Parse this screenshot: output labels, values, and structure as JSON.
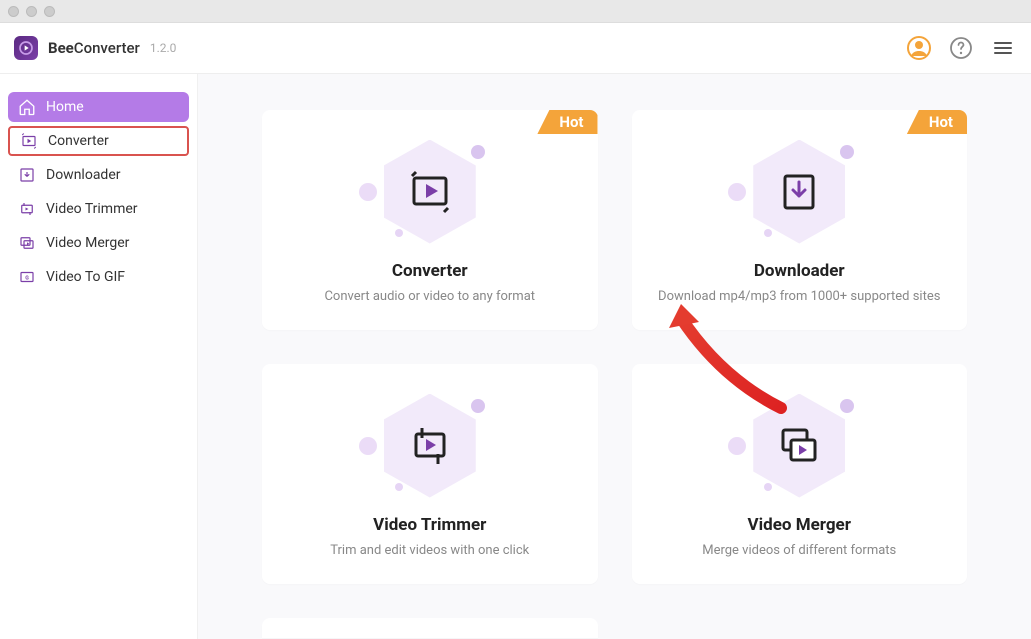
{
  "header": {
    "app_name_prefix": "Bee",
    "app_name_suffix": "Converter",
    "version": "1.2.0"
  },
  "sidebar": {
    "items": [
      {
        "label": "Home"
      },
      {
        "label": "Converter"
      },
      {
        "label": "Downloader"
      },
      {
        "label": "Video Trimmer"
      },
      {
        "label": "Video Merger"
      },
      {
        "label": "Video To GIF"
      }
    ]
  },
  "cards": [
    {
      "title": "Converter",
      "desc": "Convert audio or video to any format",
      "hot": "Hot"
    },
    {
      "title": "Downloader",
      "desc": "Download mp4/mp3 from 1000+ supported sites",
      "hot": "Hot"
    },
    {
      "title": "Video Trimmer",
      "desc": "Trim and edit videos with one click"
    },
    {
      "title": "Video Merger",
      "desc": "Merge videos of different formats"
    }
  ]
}
